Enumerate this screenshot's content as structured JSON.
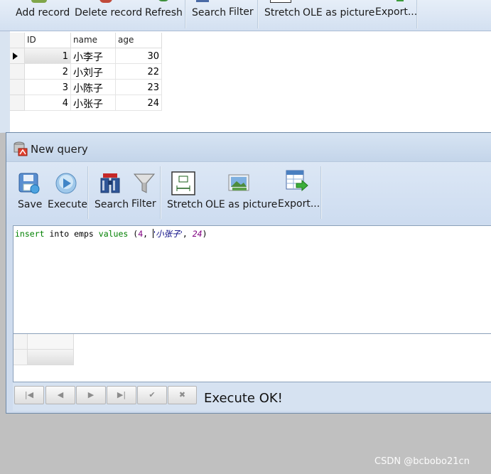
{
  "top_toolbar": {
    "add_record": "Add record",
    "delete_record": "Delete record",
    "refresh": "Refresh",
    "search": "Search",
    "filter": "Filter",
    "stretch": "Stretch",
    "ole_as_picture": "OLE as picture",
    "export": "Export..."
  },
  "table": {
    "columns": [
      "ID",
      "name",
      "age"
    ],
    "rows": [
      {
        "id": "1",
        "name": "小李子",
        "age": "30"
      },
      {
        "id": "2",
        "name": "小刘子",
        "age": "22"
      },
      {
        "id": "3",
        "name": "小陈子",
        "age": "23"
      },
      {
        "id": "4",
        "name": "小张子",
        "age": "24"
      }
    ]
  },
  "query_window": {
    "title": "New query",
    "toolbar": {
      "save": "Save",
      "execute": "Execute",
      "search": "Search",
      "filter": "Filter",
      "stretch": "Stretch",
      "ole_as_picture": "OLE as picture",
      "export": "Export..."
    },
    "sql": {
      "kw_insert": "insert",
      "kw_into": "into",
      "table": "emps",
      "kw_values": "values",
      "open_paren": "(",
      "num1": "4",
      "comma1": ",",
      "str1": "'小张子'",
      "comma2": ",",
      "num2": "24",
      "close_paren": ")"
    },
    "status": "Execute OK!"
  },
  "navigator": {
    "first": "|◀",
    "prior": "◀",
    "next": "▶",
    "last": "▶|",
    "post": "✔",
    "cancel": "✖"
  },
  "watermark": "CSDN @bcbobo21cn",
  "colors": {
    "toolbar_bg": "#dbe6f4",
    "sql_keyword": "#008000",
    "sql_number": "#800080",
    "sql_string": "#000080"
  }
}
